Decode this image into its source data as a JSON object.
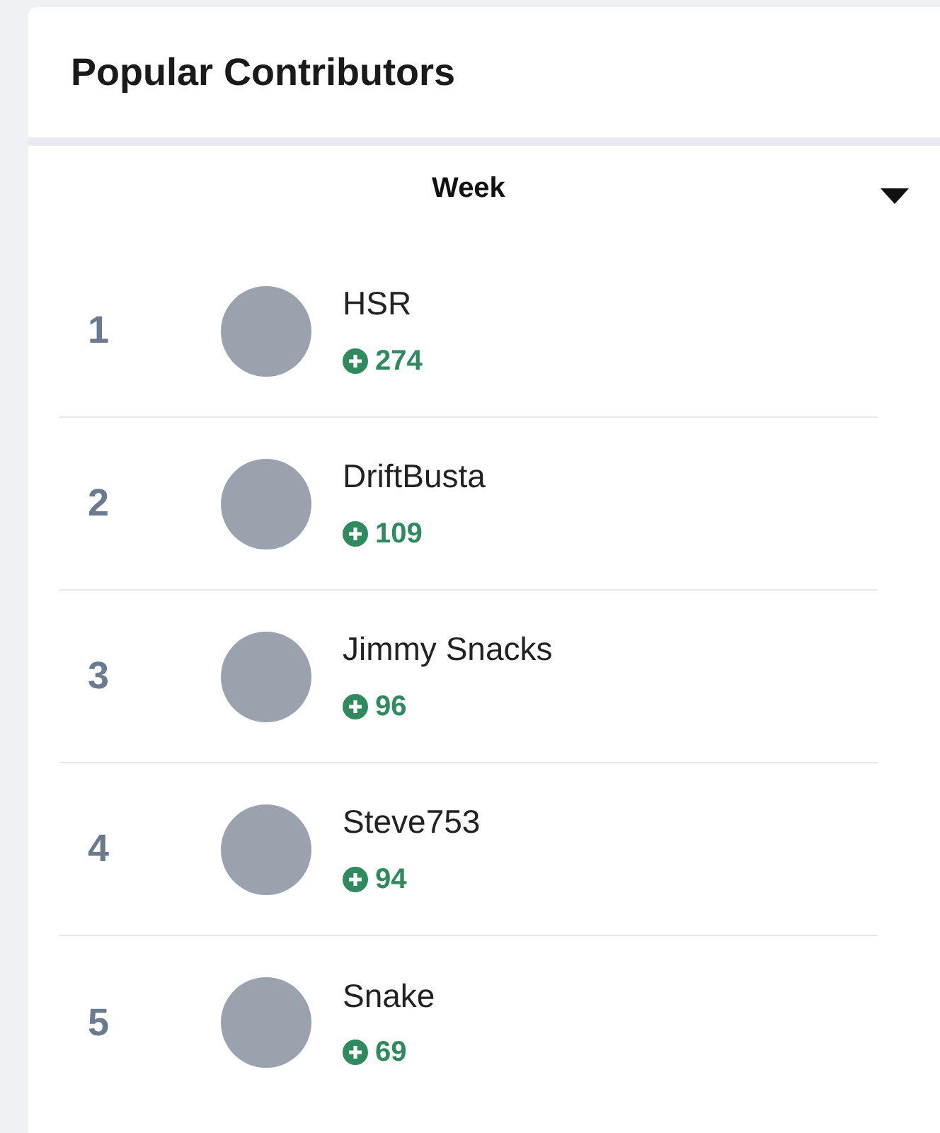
{
  "title": "Popular Contributors",
  "period": {
    "value": "Week"
  },
  "contributors": [
    {
      "rank": "1",
      "name": "HSR",
      "points": "274"
    },
    {
      "rank": "2",
      "name": "DriftBusta",
      "points": "109"
    },
    {
      "rank": "3",
      "name": "Jimmy Snacks",
      "points": "96"
    },
    {
      "rank": "4",
      "name": "Steve753",
      "points": "94"
    },
    {
      "rank": "5",
      "name": "Snake",
      "points": "69"
    }
  ]
}
